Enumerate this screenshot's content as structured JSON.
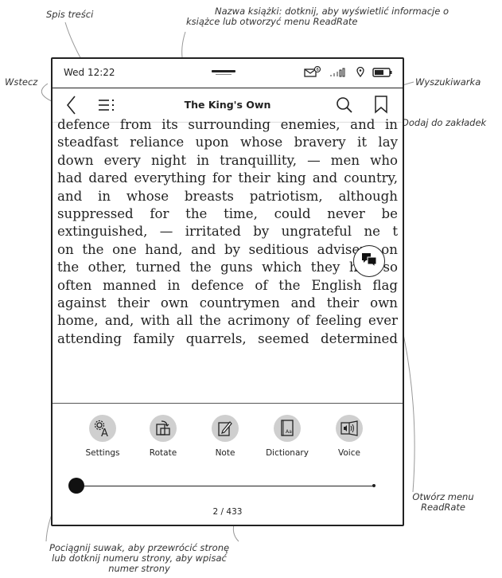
{
  "callouts": {
    "toc": "Spis treści",
    "book_name_1": "Nazwa książki: dotknij, aby wyświetlić informacje o",
    "book_name_2": "książce lub otworzyć menu ReadRate",
    "back": "Wstecz",
    "search": "Wyszukiwarka",
    "bookmark": "Dodaj do zakładek",
    "readrate_1": "Otwórz menu",
    "readrate_2": "ReadRate",
    "slider_1": "Pociągnij suwak, aby przewrócić stronę",
    "slider_2": "lub dotknij numeru strony, aby wpisać",
    "slider_3": "numer strony"
  },
  "status": {
    "time": "Wed 12:22"
  },
  "toolbar": {
    "title": "The King's Own"
  },
  "text_lines": [
    "defence from its surrounding enemies, and in",
    "steadfast reliance upon whose bravery it lay",
    "down every night in tranquillity, — men who",
    "had dared everything for their king and country,",
    "and in whose breasts patriotism, although",
    "suppressed for the time, could never be",
    "extinguished, — irritated by ungrateful ne   t",
    "on the one hand, and by seditious advisers on",
    "the other, turned the guns which they had so",
    "often manned in defence of the English flag",
    "against their own countrymen and their own",
    "home, and, with all the acrimony of feeling ever",
    "attending family quarrels, seemed determined"
  ],
  "tools": [
    {
      "label": "Settings",
      "icon": "settings-icon"
    },
    {
      "label": "Rotate",
      "icon": "rotate-icon"
    },
    {
      "label": "Note",
      "icon": "note-icon"
    },
    {
      "label": "Dictionary",
      "icon": "dictionary-icon"
    },
    {
      "label": "Voice",
      "icon": "voice-icon"
    }
  ],
  "page": {
    "indicator": "2 / 433",
    "current": 2,
    "total": 433
  },
  "dictionary_badge": "Aa"
}
